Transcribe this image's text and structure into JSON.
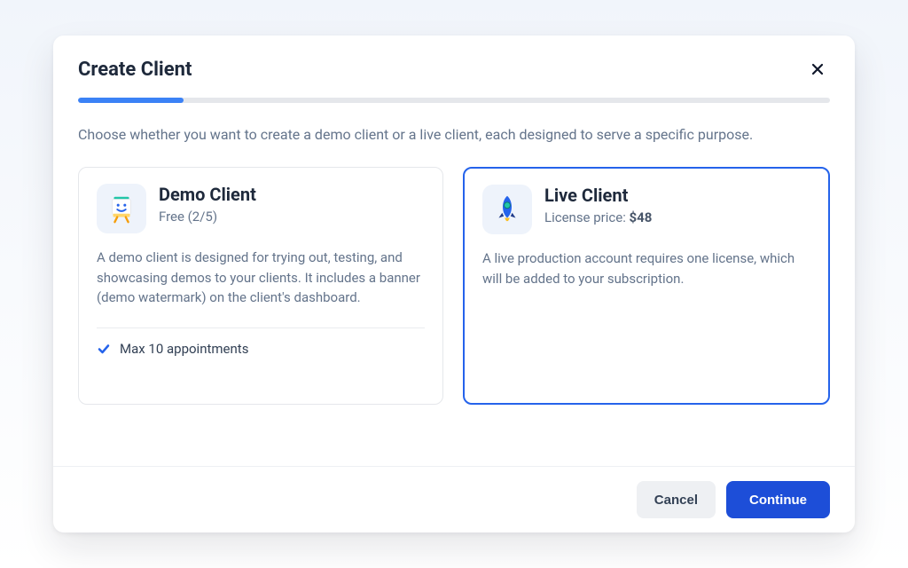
{
  "modal": {
    "title": "Create Client",
    "description": "Choose whether you want to create a demo client or a live client, each designed to serve a specific purpose.",
    "progress_percent": 14
  },
  "options": {
    "demo": {
      "title": "Demo Client",
      "subtitle": "Free (2/5)",
      "description": "A demo client is designed for trying out, testing, and showcasing demos to your clients. It includes a banner (demo watermark) on the client's dashboard.",
      "feature": "Max 10 appointments",
      "selected": false
    },
    "live": {
      "title": "Live Client",
      "price_label": "License price: ",
      "price_value": "$48",
      "description": "A live production account requires one license, which will be added to your subscription.",
      "selected": true
    }
  },
  "footer": {
    "cancel_label": "Cancel",
    "continue_label": "Continue"
  }
}
